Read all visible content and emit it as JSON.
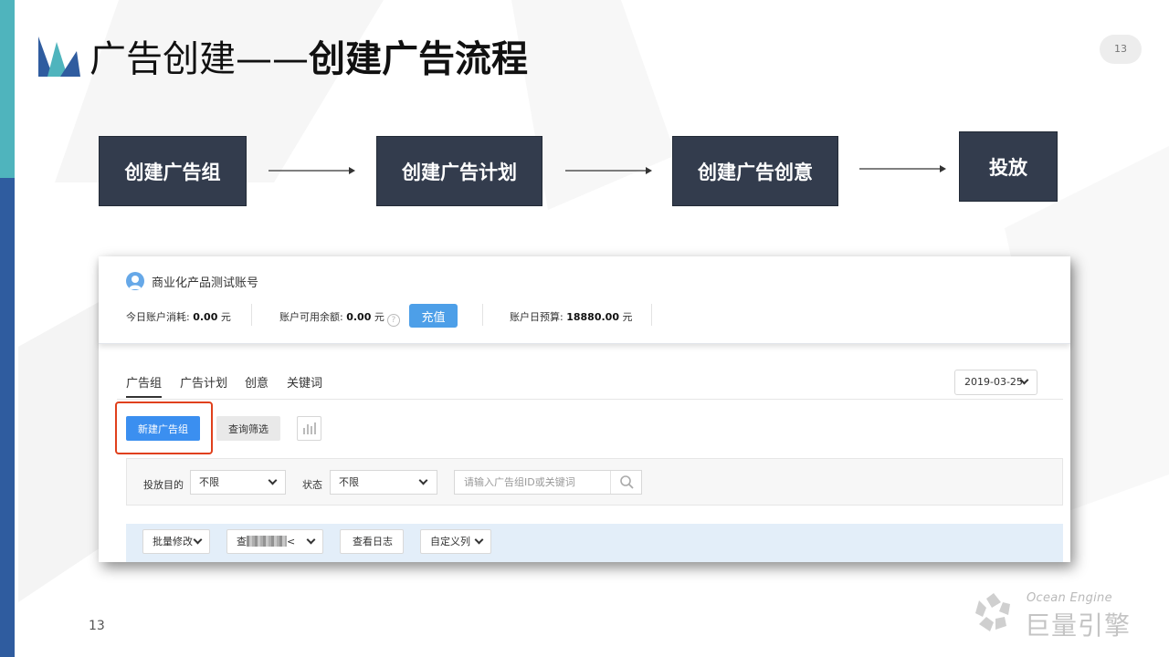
{
  "slide": {
    "title_light": "广告创建——",
    "title_bold": "创建广告流程",
    "page_badge": "13",
    "page_number": "13"
  },
  "flow": {
    "steps": [
      "创建广告组",
      "创建广告计划",
      "创建广告创意",
      "投放"
    ]
  },
  "account": {
    "name": "商业化产品测试账号",
    "today_spend_label": "今日账户消耗:",
    "today_spend_value": "0.00",
    "balance_label": "账户可用余额:",
    "balance_value": "0.00",
    "daily_budget_label": "账户日预算:",
    "daily_budget_value": "18880.00",
    "currency": "元",
    "help_glyph": "?",
    "recharge_label": "充值"
  },
  "tabs": [
    "广告组",
    "广告计划",
    "创意",
    "关键词"
  ],
  "date_select": {
    "value": "2019-03-25"
  },
  "toolbar": {
    "new_group_label": "新建广告组",
    "query_filter_label": "查询筛选"
  },
  "filters": {
    "purpose_label": "投放目的",
    "purpose_value": "不限",
    "status_label": "状态",
    "status_value": "不限",
    "search_placeholder": "请输入广告组ID或关键词"
  },
  "batch": {
    "modify_label": "批量修改",
    "view_label_prefix": "查",
    "view_label_suffix": "<",
    "log_label": "查看日志",
    "custom_cols_label": "自定义列"
  },
  "brand": {
    "en": "Ocean Engine",
    "cn": "巨量引擎"
  },
  "colors": {
    "step_bg": "#333c4d",
    "primary_blue": "#3b8ff0",
    "highlight_red": "#e0401c",
    "stripe_teal": "#4fb4bd",
    "stripe_navy": "#2f5c9f"
  }
}
